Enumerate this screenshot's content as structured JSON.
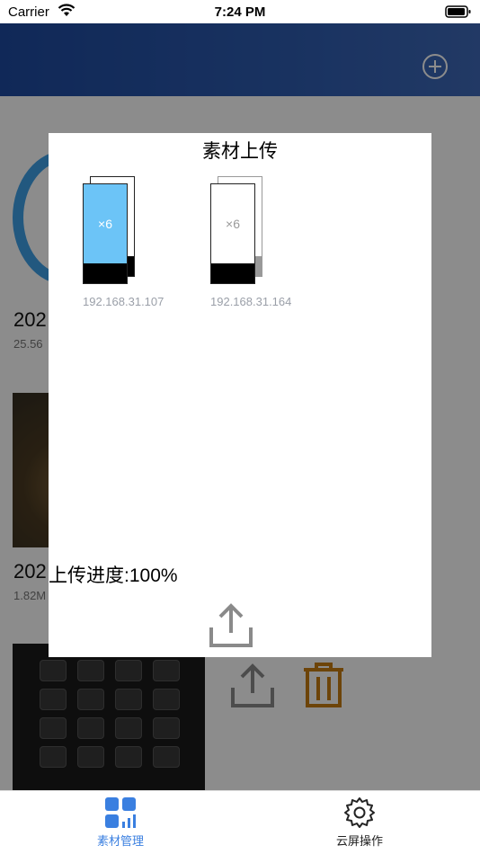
{
  "status_bar": {
    "carrier": "Carrier",
    "time": "7:24 PM"
  },
  "list": {
    "items": [
      {
        "title": "202",
        "size": "25.56"
      },
      {
        "title": "202",
        "size": "1.82M"
      }
    ]
  },
  "modal": {
    "title": "素材上传",
    "devices": [
      {
        "count": "×6",
        "ip": "192.168.31.107",
        "state": "selected",
        "color": "#6cc4f7"
      },
      {
        "count": "×6",
        "ip": "192.168.31.164",
        "state": "unselected",
        "color": "#ffffff"
      }
    ],
    "progress_label": "上传进度:100%"
  },
  "tabbar": {
    "tabs": [
      {
        "label": "素材管理",
        "icon": "grid-chart-icon",
        "active": true,
        "color": "#3a7fe0"
      },
      {
        "label": "云屏操作",
        "icon": "gear-icon",
        "active": false,
        "color": "#222222"
      }
    ]
  },
  "colors": {
    "header": "#2e5cb0",
    "accent": "#3a7fe0",
    "trash": "#c77d12"
  }
}
